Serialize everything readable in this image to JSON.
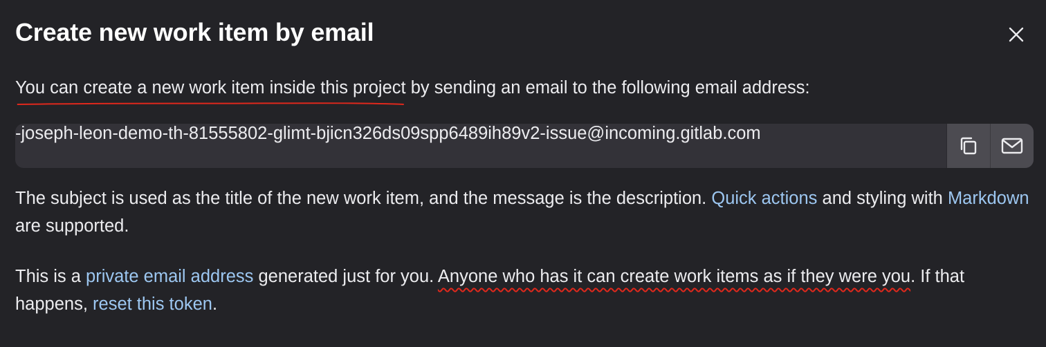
{
  "modal": {
    "title": "Create new work item by email",
    "close_icon": "close-icon"
  },
  "intro": {
    "highlighted": "You can create a new work item inside this project",
    "rest": " by sending an email to the following email address:"
  },
  "email_field": {
    "value": "-joseph-leon-demo-th-81555802-glimt-bjicn326ds09spp6489ih89v2-issue@incoming.gitlab.com",
    "copy_icon": "copy-icon",
    "mail_icon": "mail-icon"
  },
  "subject_info": {
    "text_before": "The subject is used as the title of the new work item, and the message is the description. ",
    "quick_actions_link": "Quick actions",
    "text_middle": " and styling with ",
    "markdown_link": "Markdown",
    "text_after": " are supported."
  },
  "private_info": {
    "text_before": "This is a ",
    "private_link": "private email address",
    "text_middle": " generated just for you. ",
    "highlighted": "Anyone who has it can create work items as if they were you",
    "text_after_highlight": ". If that happens, ",
    "reset_link": "reset this token",
    "text_end": "."
  },
  "colors": {
    "background": "#232327",
    "field_background": "#333238",
    "button_background": "#4c4b51",
    "link": "#9dc7f1",
    "annotation_underline": "#e0281c"
  }
}
